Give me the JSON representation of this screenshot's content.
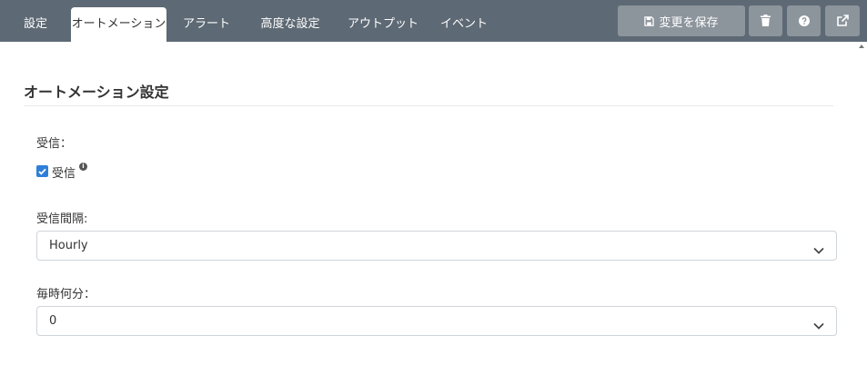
{
  "tabs": [
    {
      "label": "設定",
      "active": false
    },
    {
      "label": "オートメーション",
      "active": true
    },
    {
      "label": "アラート",
      "active": false
    },
    {
      "label": "高度な設定",
      "active": false
    },
    {
      "label": "アウトプット",
      "active": false
    },
    {
      "label": "イベント",
      "active": false
    }
  ],
  "toolbar": {
    "save_label": "変更を保存",
    "icons": [
      "save-icon",
      "trash-icon",
      "help-icon",
      "external-link-icon"
    ]
  },
  "section": {
    "title": "オートメーション設定"
  },
  "fields": {
    "receive": {
      "label": "受信：",
      "checkbox_label": "受信",
      "checked": true
    },
    "interval": {
      "label": "受信間隔:",
      "value": "Hourly"
    },
    "minute": {
      "label": "毎時何分：",
      "value": "0"
    }
  },
  "colors": {
    "topbar": "#5d6974",
    "toolbar_button": "#8c949c",
    "checkbox": "#2f7fd8"
  }
}
